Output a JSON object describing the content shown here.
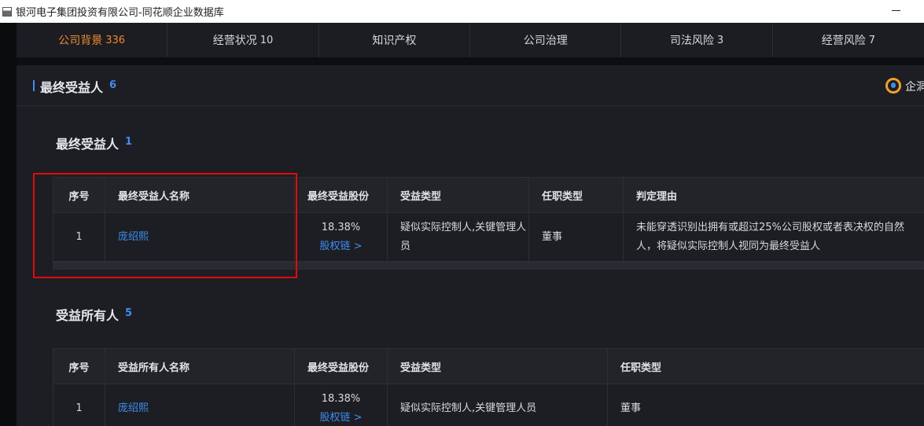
{
  "window": {
    "title": "银河电子集团投资有限公司-同花顺企业数据库"
  },
  "tabs": [
    {
      "label": "公司背景",
      "count": "336",
      "active": true
    },
    {
      "label": "经营状况",
      "count": "10",
      "active": false
    },
    {
      "label": "知识产权",
      "count": "",
      "active": false
    },
    {
      "label": "公司治理",
      "count": "",
      "active": false
    },
    {
      "label": "司法风险",
      "count": "3",
      "active": false
    },
    {
      "label": "经营风险",
      "count": "7",
      "active": false
    }
  ],
  "panel": {
    "title": "最终受益人",
    "count": "6",
    "brand_text": "企洞"
  },
  "beneficiaries": {
    "title": "最终受益人",
    "count": "1",
    "columns": [
      "序号",
      "最终受益人名称",
      "最终受益股份",
      "受益类型",
      "任职类型",
      "判定理由"
    ],
    "rows": [
      {
        "seq": "1",
        "name": "庞绍熙",
        "ratio": "18.38%",
        "chain": "股权链 >",
        "type": "疑似实际控制人,关键管理人员",
        "position": "董事",
        "reason": "未能穿透识别出拥有或超过25%公司股权或者表决权的自然人，将疑似实际控制人视同为最终受益人"
      }
    ]
  },
  "owners": {
    "title": "受益所有人",
    "count": "5",
    "columns": [
      "序号",
      "受益所有人名称",
      "最终受益股份",
      "受益类型",
      "任职类型"
    ],
    "rows": [
      {
        "seq": "1",
        "name": "庞绍熙",
        "ratio": "18.38%",
        "chain": "股权链 >",
        "type": "疑似实际控制人,关键管理人员",
        "position": "董事"
      }
    ]
  },
  "colors": {
    "accent_blue": "#3a8ff0",
    "active_tab": "#f08a2c",
    "highlight_red": "#e00c0c"
  }
}
